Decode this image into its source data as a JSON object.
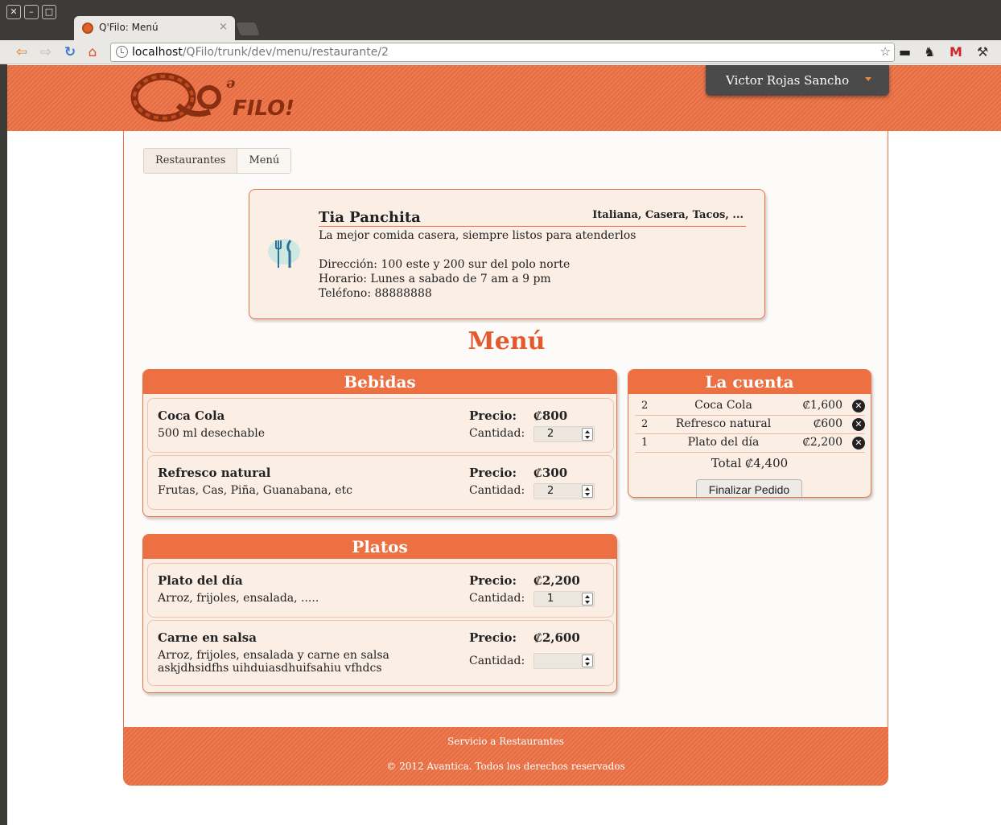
{
  "browser": {
    "tab_title": "Q'Filo: Menú",
    "tab_close": "×",
    "url_host": "localhost",
    "url_path": "/QFilo/trunk/dev/menu/restaurante/2"
  },
  "header": {
    "logo_text": "FILO!",
    "user_name": "Victor Rojas Sancho"
  },
  "breadcrumb": [
    "Restaurantes",
    "Menú"
  ],
  "restaurant": {
    "name": "Tia Panchita",
    "tags": "Italiana, Casera, Tacos, ...",
    "description": "La mejor comida casera, siempre listos para atenderlos",
    "address": "Dirección: 100 este y 200 sur del polo norte",
    "hours": "Horario: Lunes a sabado de 7 am a 9 pm",
    "phone": "Teléfono: 88888888"
  },
  "menu_title": "Menú",
  "labels": {
    "price": "Precio:",
    "quantity": "Cantidad:"
  },
  "sections": [
    {
      "title": "Bebidas",
      "items": [
        {
          "name": "Coca Cola",
          "desc": "500 ml desechable",
          "price": "₡800",
          "qty": "2"
        },
        {
          "name": "Refresco natural",
          "desc": "Frutas, Cas, Piña, Guanabana, etc",
          "price": "₡300",
          "qty": "2"
        }
      ]
    },
    {
      "title": "Platos",
      "items": [
        {
          "name": "Plato del día",
          "desc": "Arroz, frijoles, ensalada, .....",
          "price": "₡2,200",
          "qty": "1"
        },
        {
          "name": "Carne en salsa",
          "desc": "Arroz, frijoles, ensalada y carne en salsa askjdhsidfhs uihduiasdhuifsahiu vfhdcs",
          "price": "₡2,600",
          "qty": ""
        }
      ]
    }
  ],
  "bill": {
    "title": "La cuenta",
    "rows": [
      {
        "qty": "2",
        "name": "Coca Cola",
        "amount": "₡1,600"
      },
      {
        "qty": "2",
        "name": "Refresco natural",
        "amount": "₡600"
      },
      {
        "qty": "1",
        "name": "Plato del día",
        "amount": "₡2,200"
      }
    ],
    "total": "Total ₡4,400",
    "finish_label": "Finalizar Pedido"
  },
  "footer": {
    "line1": "Servicio a Restaurantes",
    "line2": "© 2012 Avantica. Todos los derechos reservados"
  },
  "colors": {
    "accent": "#ed7043",
    "heading": "#e25a2c",
    "panel_bg": "#faeee5"
  }
}
